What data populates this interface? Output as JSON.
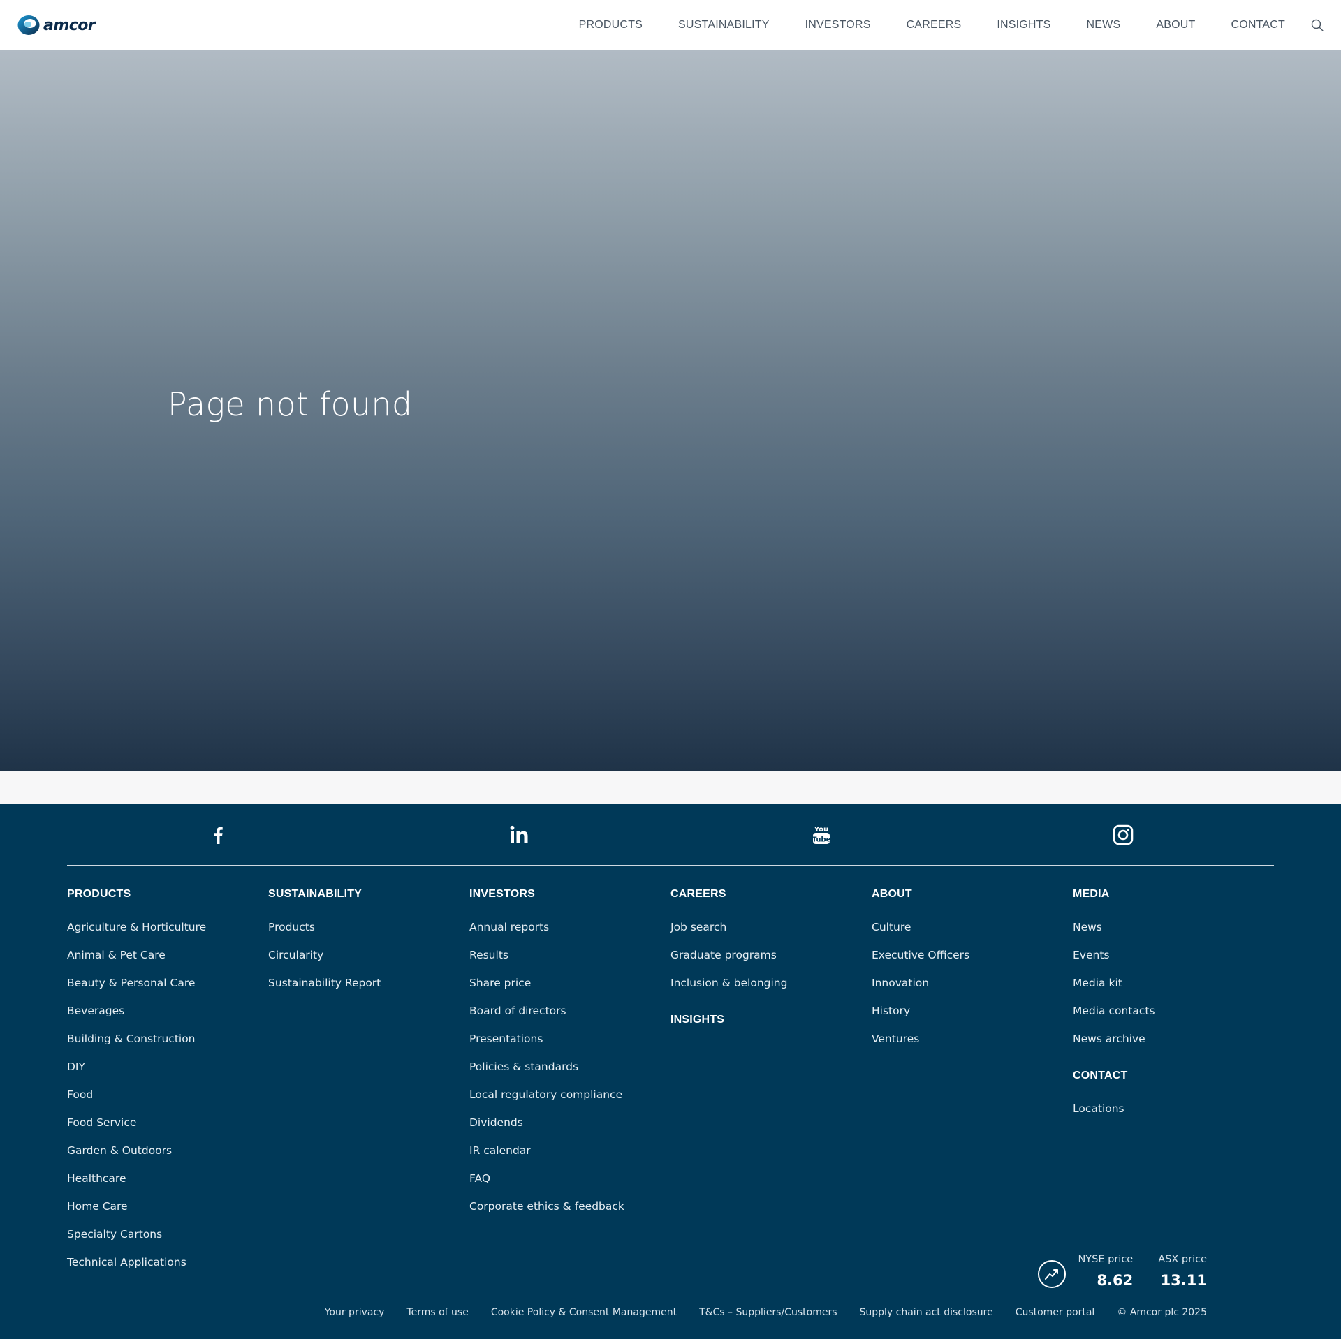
{
  "header": {
    "logo_text": "amcor",
    "nav": [
      "PRODUCTS",
      "SUSTAINABILITY",
      "INVESTORS",
      "CAREERS",
      "INSIGHTS",
      "NEWS",
      "ABOUT",
      "CONTACT"
    ],
    "search_icon": "search-icon"
  },
  "hero": {
    "title": "Page not found"
  },
  "footer": {
    "social": [
      "facebook-icon",
      "linkedin-icon",
      "youtube-icon",
      "instagram-icon"
    ],
    "columns": [
      {
        "heading": "PRODUCTS",
        "links": [
          "Agriculture & Horticulture",
          "Animal & Pet Care",
          "Beauty & Personal Care",
          "Beverages",
          "Building & Construction",
          "DIY",
          "Food",
          "Food Service",
          "Garden & Outdoors",
          "Healthcare",
          "Home Care",
          "Specialty Cartons",
          "Technical Applications"
        ]
      },
      {
        "heading": "SUSTAINABILITY",
        "links": [
          "Products",
          "Circularity",
          "Sustainability Report"
        ]
      },
      {
        "heading": "INVESTORS",
        "links": [
          "Annual reports",
          "Results",
          "Share price",
          "Board of directors",
          "Presentations",
          "Policies & standards",
          "Local regulatory compliance",
          "Dividends",
          "IR calendar",
          "FAQ",
          "Corporate ethics & feedback"
        ]
      },
      {
        "heading": "CAREERS",
        "links": [
          "Job search",
          "Graduate programs",
          "Inclusion & belonging"
        ],
        "second_heading": "INSIGHTS"
      },
      {
        "heading": "ABOUT",
        "links": [
          "Culture",
          "Executive Officers",
          "Innovation",
          "History",
          "Ventures"
        ]
      },
      {
        "heading": "MEDIA",
        "links": [
          "News",
          "Events",
          "Media kit",
          "Media contacts",
          "News archive"
        ],
        "second_heading": "CONTACT",
        "second_links": [
          "Locations"
        ]
      }
    ],
    "prices": {
      "nyse_label": "NYSE price",
      "nyse_value": "8.62",
      "asx_label": "ASX price",
      "asx_value": "13.11"
    },
    "legal": [
      "Your privacy",
      "Terms of use",
      "Cookie Policy & Consent Management",
      "T&Cs – Suppliers/Customers",
      "Supply chain act disclosure",
      "Customer portal"
    ],
    "copyright": "© Amcor plc 2025"
  },
  "colors": {
    "footer_bg": "#003958",
    "brand_dark": "#0b2a4a",
    "nav_text": "#4a5663"
  }
}
